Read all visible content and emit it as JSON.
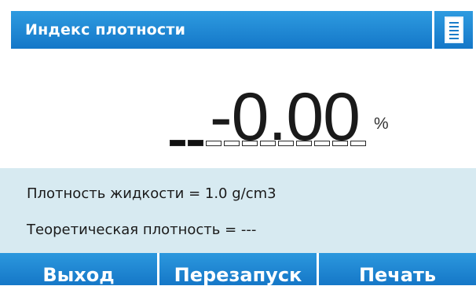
{
  "header": {
    "title": "Индекс плотности",
    "menu_icon": "menu-list-icon"
  },
  "display": {
    "value": "-0.00",
    "unit": "%",
    "bargraph": {
      "segments": 11,
      "filled": 2
    }
  },
  "info": {
    "liquid_density": "Плотность жидкости = 1.0 g/cm3",
    "theoretical_density": "Теоретическая плотность = ---"
  },
  "footer": {
    "buttons": [
      {
        "label": "Выход"
      },
      {
        "label": "Перезапуск"
      },
      {
        "label": "Печать"
      }
    ]
  },
  "colors": {
    "accent": "#1a84d2",
    "info_background": "#d7eaf1"
  }
}
